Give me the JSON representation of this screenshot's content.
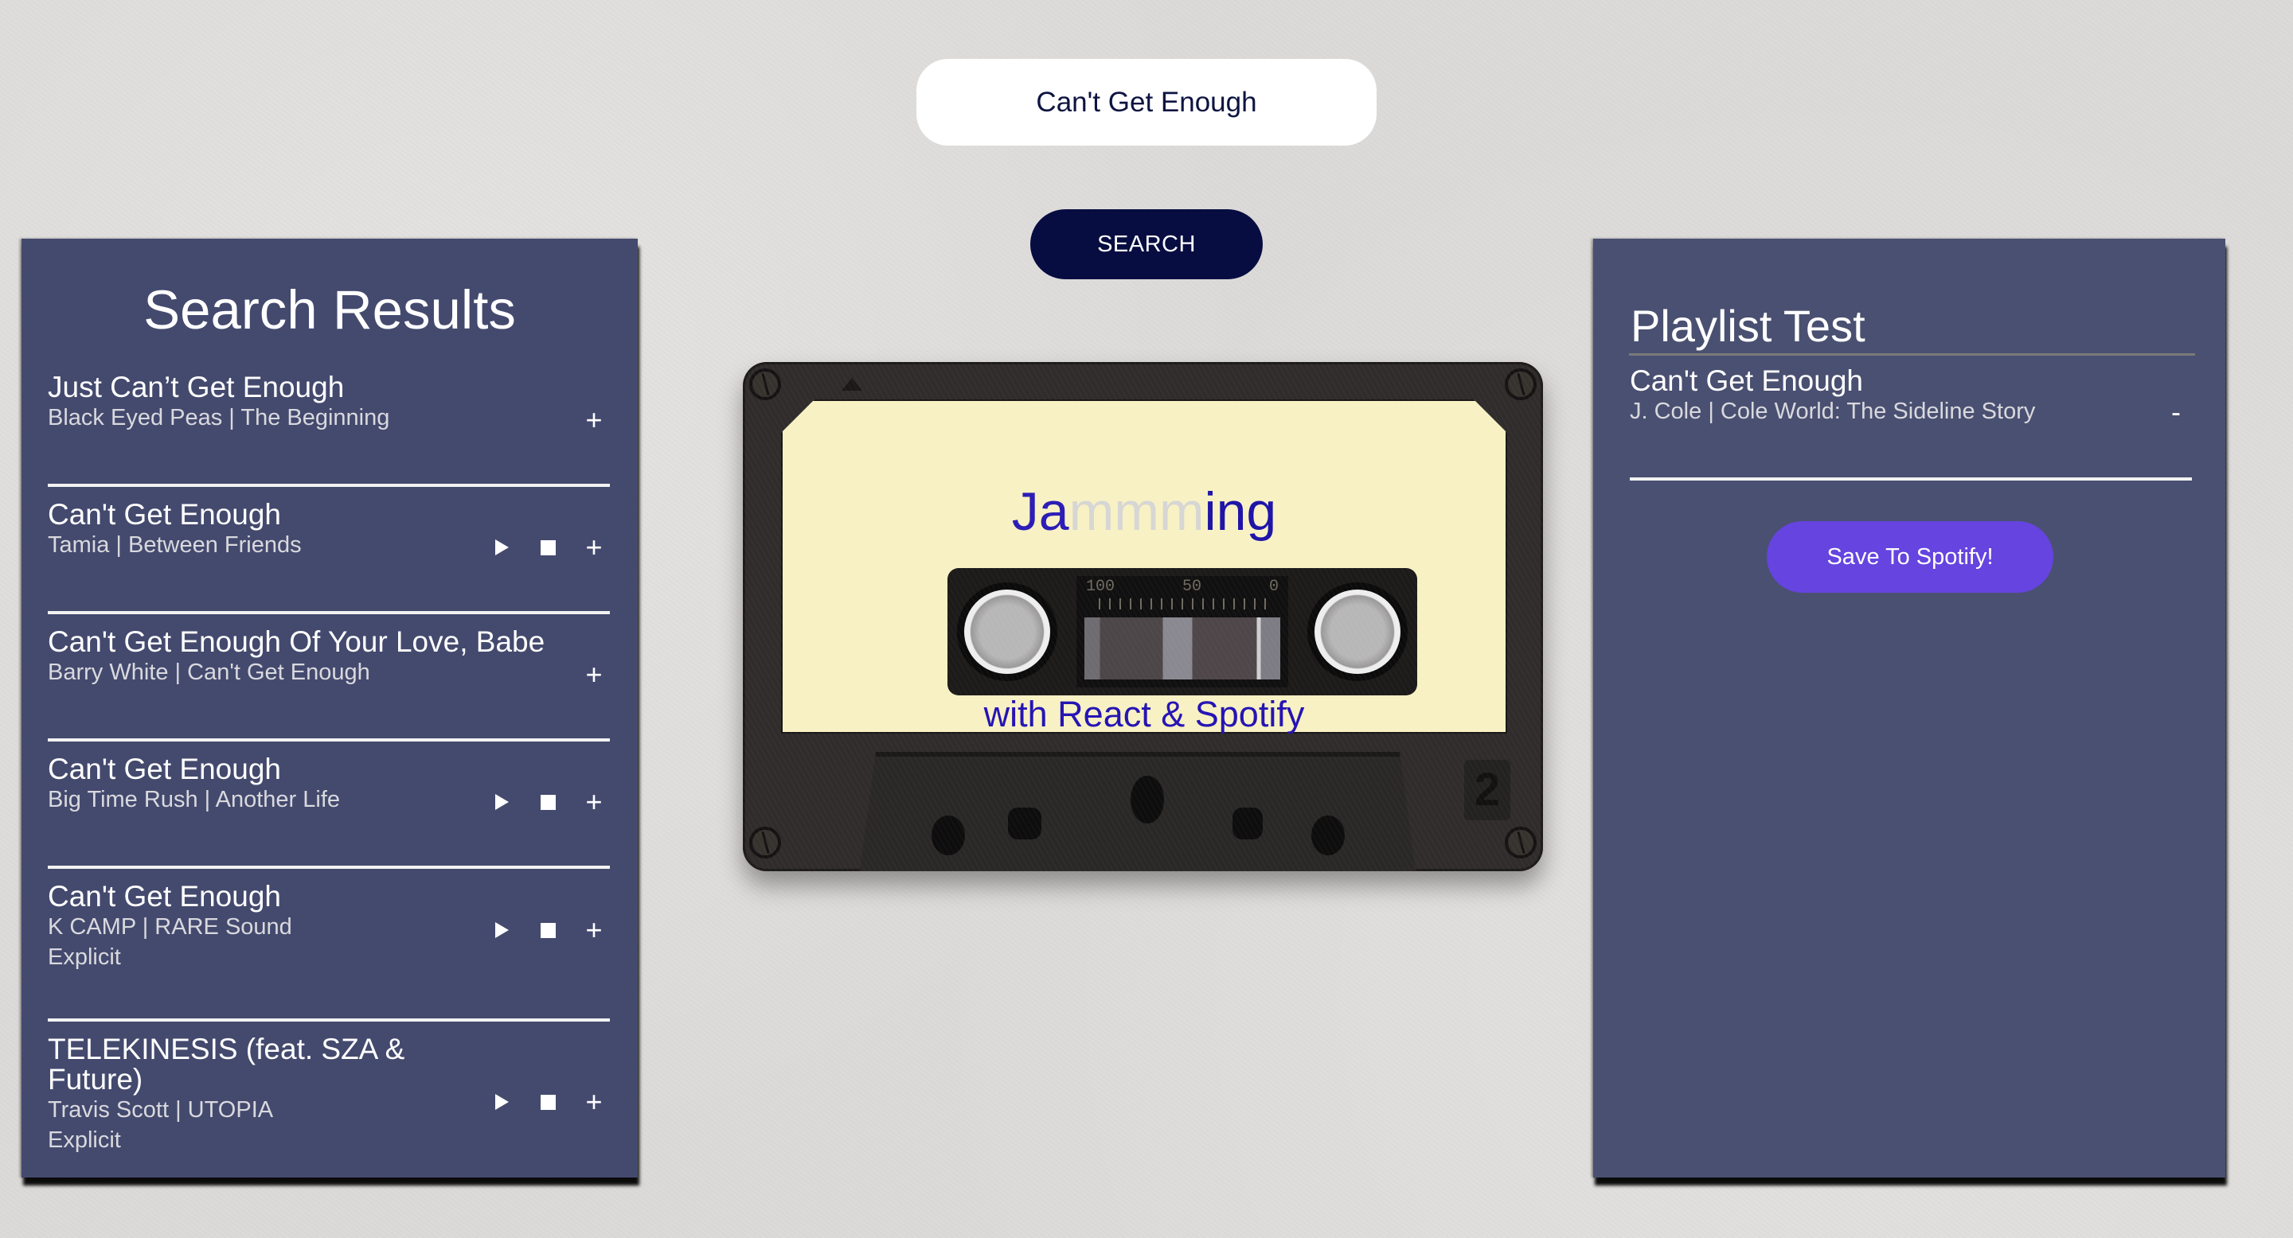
{
  "search": {
    "value": "Can't Get Enough",
    "button_label": "SEARCH"
  },
  "results": {
    "title": "Search Results",
    "tracks": [
      {
        "name": "Just Can’t Get Enough",
        "meta": "Black Eyed Peas | The Beginning",
        "explicit": "",
        "has_preview": false
      },
      {
        "name": "Can't Get Enough",
        "meta": "Tamia | Between Friends",
        "explicit": "",
        "has_preview": true
      },
      {
        "name": "Can't Get Enough Of Your Love, Babe",
        "meta": "Barry White | Can't Get Enough",
        "explicit": "",
        "has_preview": false
      },
      {
        "name": "Can't Get Enough",
        "meta": "Big Time Rush | Another Life",
        "explicit": "",
        "has_preview": true
      },
      {
        "name": "Can't Get Enough",
        "meta": "K CAMP | RARE Sound",
        "explicit": "Explicit",
        "has_preview": true
      },
      {
        "name": "TELEKINESIS (feat. SZA & Future)",
        "meta": "Travis Scott | UTOPIA",
        "explicit": "Explicit",
        "has_preview": true
      }
    ],
    "add_symbol": "+"
  },
  "cassette": {
    "title_a": "Ja",
    "title_b": "mmm",
    "title_c": "ing",
    "subtitle": "with React & Spotify",
    "counter": [
      "100",
      "50",
      "0"
    ],
    "side": "2"
  },
  "playlist": {
    "name": "Playlist Test",
    "tracks": [
      {
        "name": "Can't Get Enough",
        "meta": "J. Cole | Cole World: The Sideline Story"
      }
    ],
    "remove_symbol": "-",
    "save_label": "Save To Spotify!"
  },
  "colors": {
    "panel": "#444a6e",
    "search_button": "#070d41",
    "save_button": "#6544e0",
    "cassette_text": "#2a1cb5"
  }
}
